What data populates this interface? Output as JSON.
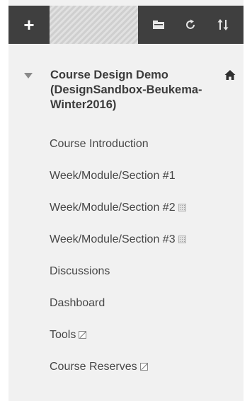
{
  "toolbar": {
    "add_label": "+",
    "icons": [
      "folder-icon",
      "refresh-icon",
      "sort-icon"
    ]
  },
  "course": {
    "title": "Course Design Demo (DesignSandbox-Beukema-Winter2016)",
    "home_icon": "home-icon"
  },
  "menu": {
    "items": [
      {
        "label": "Course Introduction",
        "status": ""
      },
      {
        "label": "Week/Module/Section #1",
        "status": ""
      },
      {
        "label": "Week/Module/Section #2",
        "status": "hidden"
      },
      {
        "label": "Week/Module/Section #3",
        "status": "hidden"
      },
      {
        "label": "Discussions",
        "status": ""
      },
      {
        "label": "Dashboard",
        "status": ""
      },
      {
        "label": "Tools",
        "status": "no-link"
      },
      {
        "label": "Course Reserves",
        "status": "no-link"
      }
    ]
  },
  "colors": {
    "toolbar_bg": "#3f3f3f",
    "panel_bg": "#f1f1f1",
    "text": "#474747",
    "title_text": "#3b3b3b"
  }
}
